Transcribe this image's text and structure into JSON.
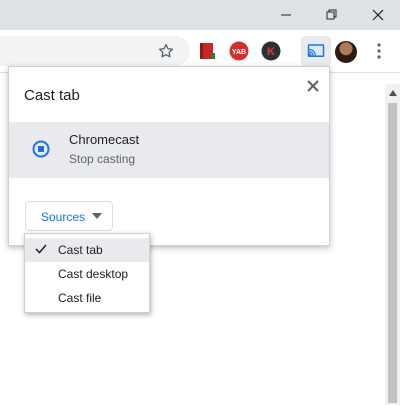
{
  "colors": {
    "accent_blue": "#1a73e8",
    "cast_active_bg": "#e8eaed",
    "device_row_bg": "#e8eaed",
    "titlebar_bg": "#dee1e6"
  },
  "window": {
    "controls": [
      "minimize-icon",
      "restore-icon",
      "close-icon"
    ]
  },
  "toolbar": {
    "icons": [
      "bookmark-star-icon",
      "red-book-extension-icon",
      "yab-extension-icon",
      "k-extension-icon",
      "cast-icon",
      "profile-avatar",
      "more-vert-icon"
    ],
    "yab_text": "YAB",
    "k_text": "K"
  },
  "cast_dialog": {
    "title": "Cast tab",
    "device": {
      "name": "Chromecast",
      "status": "Stop casting",
      "icon": "casting-active-icon"
    },
    "sources_label": "Sources"
  },
  "sources_menu": {
    "items": [
      {
        "label": "Cast tab",
        "checked": true
      },
      {
        "label": "Cast desktop",
        "checked": false
      },
      {
        "label": "Cast file",
        "checked": false
      }
    ]
  }
}
